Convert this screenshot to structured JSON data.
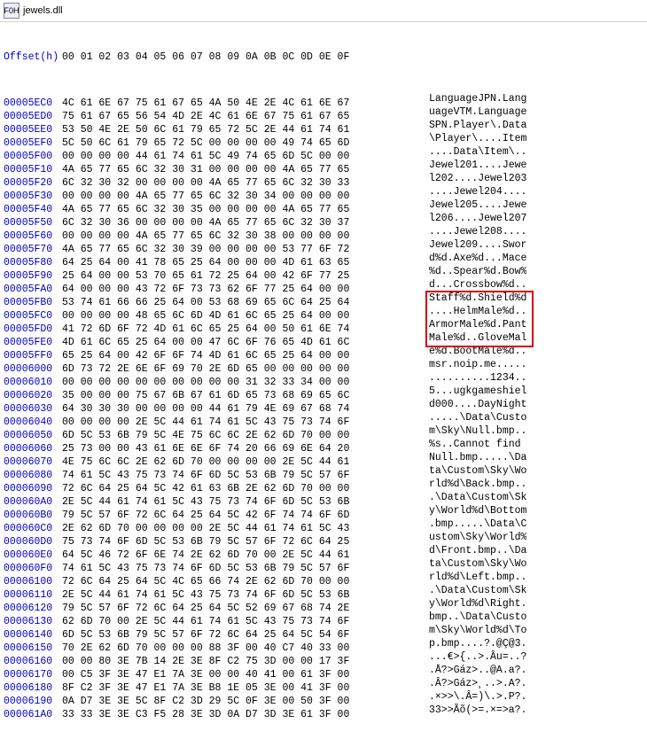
{
  "window": {
    "icon_text": "F0H",
    "title": "jewels.dll"
  },
  "header": {
    "offset_label": "Offset(h)",
    "cols": "00 01 02 03 04 05 06 07 08 09 0A 0B 0C 0D 0E 0F"
  },
  "rows": [
    {
      "o": "00005EC0",
      "b": "4C 61 6E 67 75 61 67 65 4A 50 4E 2E 4C 61 6E 67",
      "a": "LanguageJPN.Lang"
    },
    {
      "o": "00005ED0",
      "b": "75 61 67 65 56 54 4D 2E 4C 61 6E 67 75 61 67 65",
      "a": "uageVTM.Language"
    },
    {
      "o": "00005EE0",
      "b": "53 50 4E 2E 50 6C 61 79 65 72 5C 2E 44 61 74 61",
      "a": "SPN.Player\\.Data"
    },
    {
      "o": "00005EF0",
      "b": "5C 50 6C 61 79 65 72 5C 00 00 00 00 49 74 65 6D",
      "a": "\\Player\\....Item"
    },
    {
      "o": "00005F00",
      "b": "00 00 00 00 44 61 74 61 5C 49 74 65 6D 5C 00 00",
      "a": "....Data\\Item\\.."
    },
    {
      "o": "00005F10",
      "b": "4A 65 77 65 6C 32 30 31 00 00 00 00 4A 65 77 65",
      "a": "Jewel201....Jewe"
    },
    {
      "o": "00005F20",
      "b": "6C 32 30 32 00 00 00 00 4A 65 77 65 6C 32 30 33",
      "a": "l202....Jewel203"
    },
    {
      "o": "00005F30",
      "b": "00 00 00 00 4A 65 77 65 6C 32 30 34 00 00 00 00",
      "a": "....Jewel204...."
    },
    {
      "o": "00005F40",
      "b": "4A 65 77 65 6C 32 30 35 00 00 00 00 4A 65 77 65",
      "a": "Jewel205....Jewe"
    },
    {
      "o": "00005F50",
      "b": "6C 32 30 36 00 00 00 00 4A 65 77 65 6C 32 30 37",
      "a": "l206....Jewel207"
    },
    {
      "o": "00005F60",
      "b": "00 00 00 00 4A 65 77 65 6C 32 30 38 00 00 00 00",
      "a": "....Jewel208...."
    },
    {
      "o": "00005F70",
      "b": "4A 65 77 65 6C 32 30 39 00 00 00 00 53 77 6F 72",
      "a": "Jewel209....Swor"
    },
    {
      "o": "00005F80",
      "b": "64 25 64 00 41 78 65 25 64 00 00 00 4D 61 63 65",
      "a": "d%d.Axe%d...Mace"
    },
    {
      "o": "00005F90",
      "b": "25 64 00 00 53 70 65 61 72 25 64 00 42 6F 77 25",
      "a": "%d..Spear%d.Bow%"
    },
    {
      "o": "00005FA0",
      "b": "64 00 00 00 43 72 6F 73 73 62 6F 77 25 64 00 00",
      "a": "d...Crossbow%d.."
    },
    {
      "o": "00005FB0",
      "b": "53 74 61 66 66 25 64 00 53 68 69 65 6C 64 25 64",
      "a": "Staff%d.Shield%d"
    },
    {
      "o": "00005FC0",
      "b": "00 00 00 00 48 65 6C 6D 4D 61 6C 65 25 64 00 00",
      "a": "....HelmMale%d.."
    },
    {
      "o": "00005FD0",
      "b": "41 72 6D 6F 72 4D 61 6C 65 25 64 00 50 61 6E 74",
      "a": "ArmorMale%d.Pant"
    },
    {
      "o": "00005FE0",
      "b": "4D 61 6C 65 25 64 00 00 47 6C 6F 76 65 4D 61 6C",
      "a": "Male%d..GloveMal"
    },
    {
      "o": "00005FF0",
      "b": "65 25 64 00 42 6F 6F 74 4D 61 6C 65 25 64 00 00",
      "a": "e%d.BootMale%d.."
    },
    {
      "o": "00006000",
      "b": "6D 73 72 2E 6E 6F 69 70 2E 6D 65 00 00 00 00 00",
      "a": "msr.noip.me....."
    },
    {
      "o": "00006010",
      "b": "00 00 00 00 00 00 00 00 00 00 31 32 33 34 00 00",
      "a": "..........1234.."
    },
    {
      "o": "00006020",
      "b": "35 00 00 00 75 67 6B 67 61 6D 65 73 68 69 65 6C",
      "a": "5...ugkgameshiel"
    },
    {
      "o": "00006030",
      "b": "64 30 30 30 00 00 00 00 44 61 79 4E 69 67 68 74",
      "a": "d000....DayNight"
    },
    {
      "o": "00006040",
      "b": "00 00 00 00 2E 5C 44 61 74 61 5C 43 75 73 74 6F",
      "a": ".....\\Data\\Custo"
    },
    {
      "o": "00006050",
      "b": "6D 5C 53 6B 79 5C 4E 75 6C 6C 2E 62 6D 70 00 00",
      "a": "m\\Sky\\Null.bmp.."
    },
    {
      "o": "00006060",
      "b": "25 73 00 00 43 61 6E 6E 6F 74 20 66 69 6E 64 20",
      "a": "%s..Cannot find "
    },
    {
      "o": "00006070",
      "b": "4E 75 6C 6C 2E 62 6D 70 00 00 00 00 2E 5C 44 61",
      "a": "Null.bmp.....\\Da"
    },
    {
      "o": "00006080",
      "b": "74 61 5C 43 75 73 74 6F 6D 5C 53 6B 79 5C 57 6F",
      "a": "ta\\Custom\\Sky\\Wo"
    },
    {
      "o": "00006090",
      "b": "72 6C 64 25 64 5C 42 61 63 6B 2E 62 6D 70 00 00",
      "a": "rld%d\\Back.bmp.."
    },
    {
      "o": "000060A0",
      "b": "2E 5C 44 61 74 61 5C 43 75 73 74 6F 6D 5C 53 6B",
      "a": ".\\Data\\Custom\\Sk"
    },
    {
      "o": "000060B0",
      "b": "79 5C 57 6F 72 6C 64 25 64 5C 42 6F 74 74 6F 6D",
      "a": "y\\World%d\\Bottom"
    },
    {
      "o": "000060C0",
      "b": "2E 62 6D 70 00 00 00 00 2E 5C 44 61 74 61 5C 43",
      "a": ".bmp.....\\Data\\C"
    },
    {
      "o": "000060D0",
      "b": "75 73 74 6F 6D 5C 53 6B 79 5C 57 6F 72 6C 64 25",
      "a": "ustom\\Sky\\World%"
    },
    {
      "o": "000060E0",
      "b": "64 5C 46 72 6F 6E 74 2E 62 6D 70 00 2E 5C 44 61",
      "a": "d\\Front.bmp..\\Da"
    },
    {
      "o": "000060F0",
      "b": "74 61 5C 43 75 73 74 6F 6D 5C 53 6B 79 5C 57 6F",
      "a": "ta\\Custom\\Sky\\Wo"
    },
    {
      "o": "00006100",
      "b": "72 6C 64 25 64 5C 4C 65 66 74 2E 62 6D 70 00 00",
      "a": "rld%d\\Left.bmp.."
    },
    {
      "o": "00006110",
      "b": "2E 5C 44 61 74 61 5C 43 75 73 74 6F 6D 5C 53 6B",
      "a": ".\\Data\\Custom\\Sk"
    },
    {
      "o": "00006120",
      "b": "79 5C 57 6F 72 6C 64 25 64 5C 52 69 67 68 74 2E",
      "a": "y\\World%d\\Right."
    },
    {
      "o": "00006130",
      "b": "62 6D 70 00 2E 5C 44 61 74 61 5C 43 75 73 74 6F",
      "a": "bmp..\\Data\\Custo"
    },
    {
      "o": "00006140",
      "b": "6D 5C 53 6B 79 5C 57 6F 72 6C 64 25 64 5C 54 6F",
      "a": "m\\Sky\\World%d\\To"
    },
    {
      "o": "00006150",
      "b": "70 2E 62 6D 70 00 00 00 88 3F 00 40 C7 40 33 00",
      "a": "p.bmp....?.@Ç@3."
    },
    {
      "o": "00006160",
      "b": "00 00 80 3E 7B 14 2E 3E 8F C2 75 3D 00 00 17 3F",
      "a": "...€>{..>.Âu=..?"
    },
    {
      "o": "00006170",
      "b": "00 C5 3F 3E 47 E1 7A 3E 00 00 40 41 00 61 3F 00",
      "a": ".Å?>Gáz>..@A.a?."
    },
    {
      "o": "00006180",
      "b": "8F C2 3F 3E 47 E1 7A 3E B8 1E 05 3E 00 41 3F 00",
      "a": ".Â?>Gáz>¸..>.A?."
    },
    {
      "o": "00006190",
      "b": "0A D7 3E 3E 5C 8F C2 3D 29 5C 0F 3E 00 50 3F 00",
      "a": ".×>>\\.Â=)\\.>.P?."
    },
    {
      "o": "000061A0",
      "b": "33 33 3E 3E C3 F5 28 3E 3D 0A D7 3D 3E 61 3F 00",
      "a": "33>>Ãõ(>=.×=>a?."
    }
  ],
  "highlight": {
    "top_row_index": 19,
    "row_span": 4,
    "ascii_col_start": 4
  }
}
